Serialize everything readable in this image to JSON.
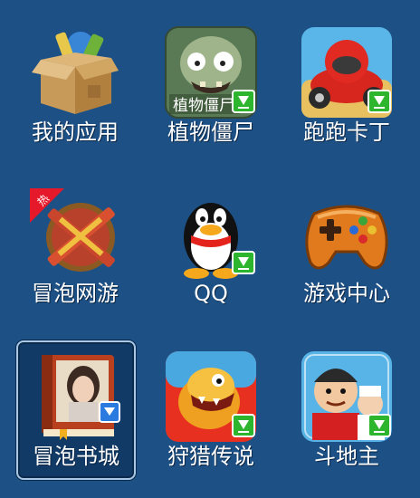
{
  "apps": [
    {
      "id": "my-apps",
      "label": "我的应用",
      "icon": "cardboard-box-icon",
      "download_badge": false
    },
    {
      "id": "plants-vs-zombies",
      "label": "植物僵尸",
      "icon": "zombie-icon",
      "icon_text": "植物僵尸",
      "download_badge": true
    },
    {
      "id": "kart-racer",
      "label": "跑跑卡丁",
      "icon": "kart-racer-icon",
      "download_badge": true
    },
    {
      "id": "bubble-network-game",
      "label": "冒泡网游",
      "icon": "crossed-swords-icon",
      "download_badge": false
    },
    {
      "id": "qq",
      "label": "QQ",
      "icon": "qq-penguin-icon",
      "download_badge": true
    },
    {
      "id": "game-center",
      "label": "游戏中心",
      "icon": "gamepad-icon",
      "download_badge": false
    },
    {
      "id": "bubble-bookstore",
      "label": "冒泡书城",
      "icon": "book-icon",
      "download_badge": true,
      "selected": true
    },
    {
      "id": "hunting-legend",
      "label": "狩猎传说",
      "icon": "dinosaur-icon",
      "download_badge": true
    },
    {
      "id": "landlord",
      "label": "斗地主",
      "icon": "landlord-card-icon",
      "download_badge": true
    }
  ],
  "colors": {
    "background": "#1d5186",
    "badge": "#2db52d",
    "selection_border": "#a9c7e6"
  }
}
